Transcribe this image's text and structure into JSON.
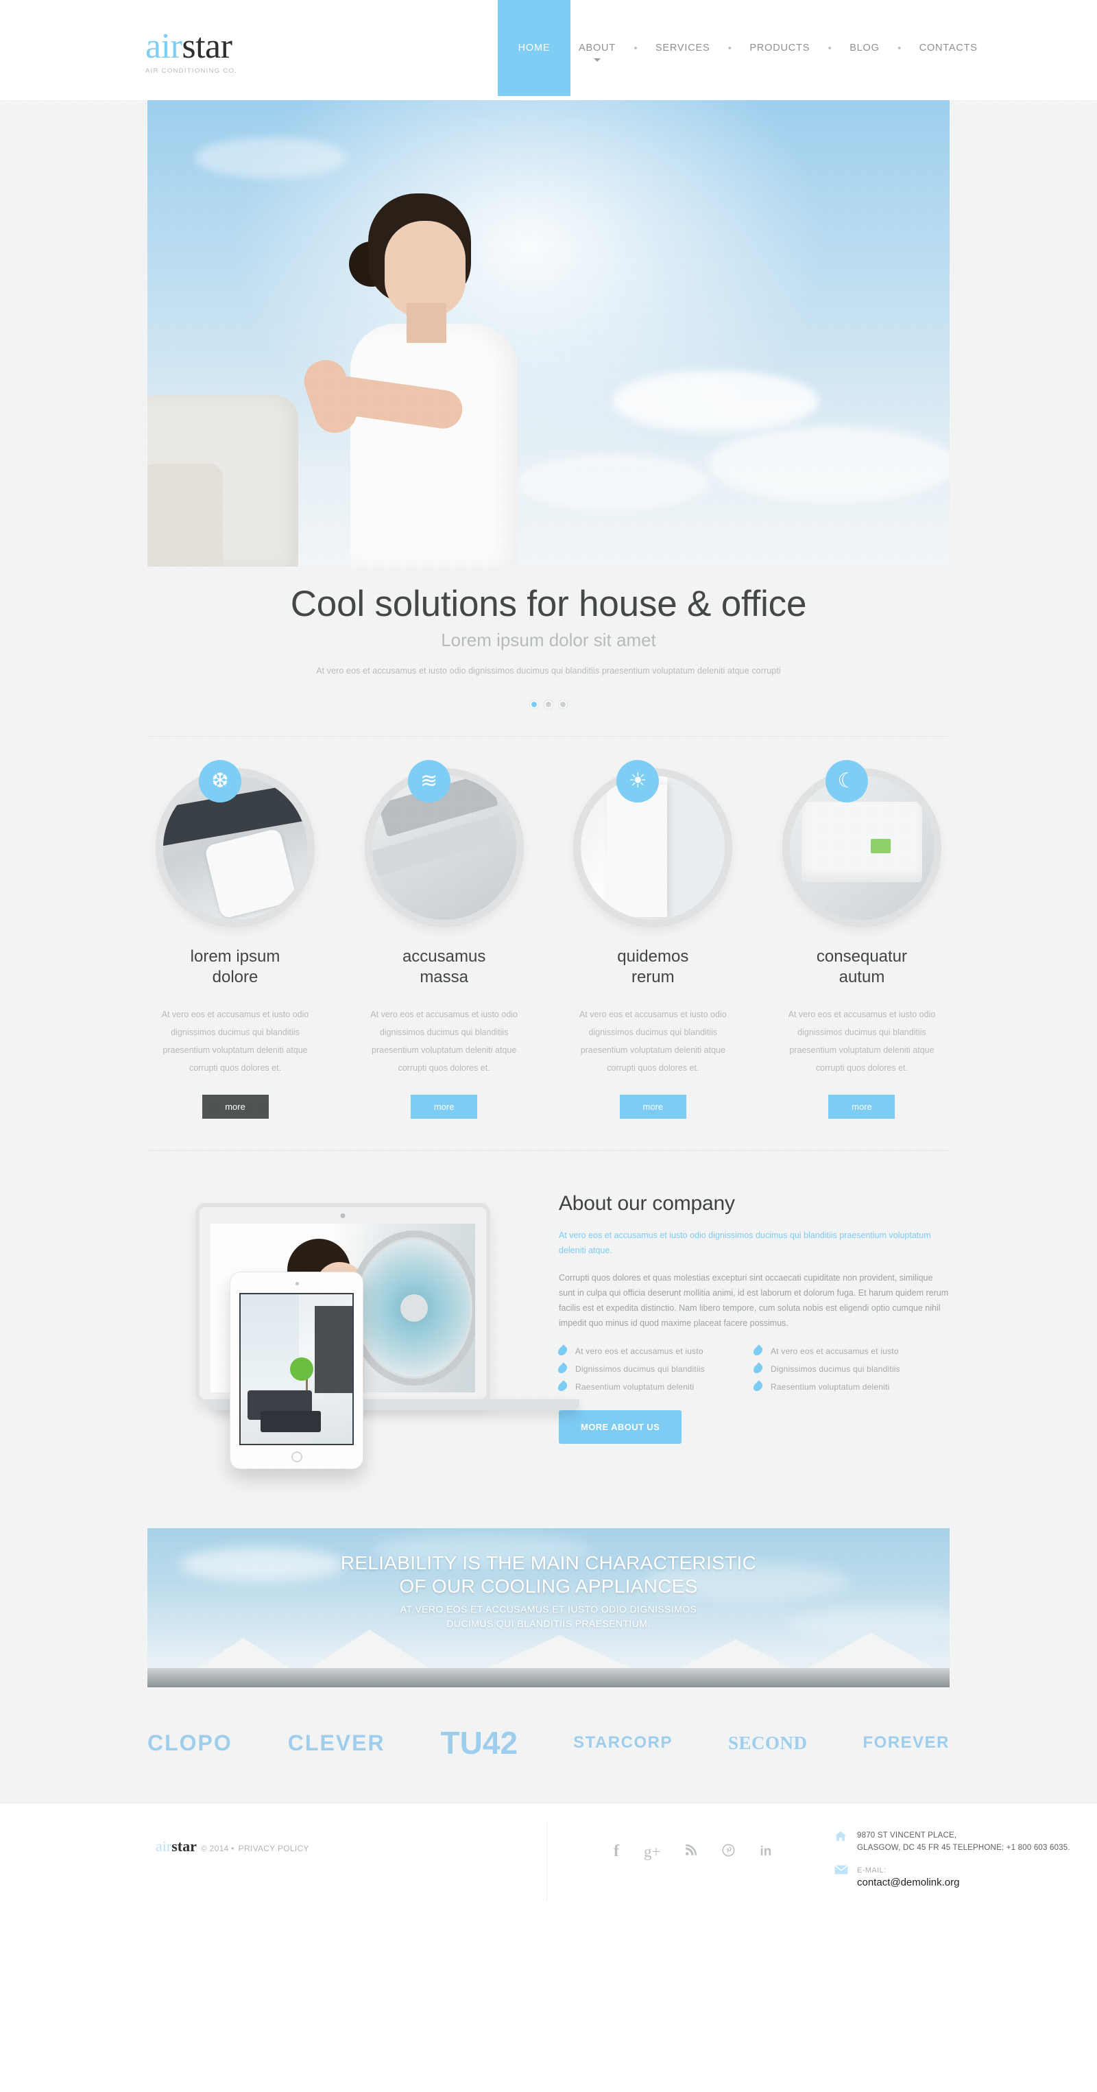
{
  "header": {
    "logo": {
      "part1": "air",
      "part2": "star",
      "tagline": "AIR CONDITIONING CO."
    },
    "nav": [
      {
        "label": "HOME",
        "active": true,
        "dropdown": false
      },
      {
        "label": "ABOUT",
        "active": false,
        "dropdown": true
      },
      {
        "label": "SERVICES",
        "active": false,
        "dropdown": false
      },
      {
        "label": "PRODUCTS",
        "active": false,
        "dropdown": false
      },
      {
        "label": "BLOG",
        "active": false,
        "dropdown": false
      },
      {
        "label": "CONTACTS",
        "active": false,
        "dropdown": false
      }
    ],
    "nav_separator": "•"
  },
  "hero": {
    "title": "Cool solutions for house & office",
    "subtitle": "Lorem ipsum dolor sit amet",
    "description": "At vero eos et accusamus et iusto odio dignissimos ducimus qui blanditiis praesentium voluptatum deleniti atque corrupti",
    "slides": [
      {
        "active": true
      },
      {
        "active": false
      },
      {
        "active": false
      }
    ]
  },
  "services": [
    {
      "icon": "snowflake-icon",
      "glyph": "❆",
      "title": "lorem ipsum\ndolore",
      "title_line1": "lorem ipsum",
      "title_line2": "dolore",
      "text": "At vero eos et accusamus et iusto odio dignissimos ducimus qui blanditiis praesentium voluptatum deleniti atque corrupti quos dolores et.",
      "button": "more",
      "button_style": "dark"
    },
    {
      "icon": "waves-icon",
      "glyph": "≋",
      "title_line1": "accusamus",
      "title_line2": "massa",
      "text": "At vero eos et accusamus et iusto odio dignissimos ducimus qui blanditiis praesentium voluptatum deleniti atque corrupti quos dolores et.",
      "button": "more",
      "button_style": "blue"
    },
    {
      "icon": "sun-icon",
      "glyph": "☀",
      "title_line1": "quidemos",
      "title_line2": "rerum",
      "text": "At vero eos et accusamus et iusto odio dignissimos ducimus qui blanditiis praesentium voluptatum deleniti atque corrupti quos dolores et.",
      "button": "more",
      "button_style": "blue"
    },
    {
      "icon": "moon-icon",
      "glyph": "☾",
      "title_line1": "consequatur",
      "title_line2": "autum",
      "text": "At vero eos et accusamus et iusto odio dignissimos ducimus qui blanditiis praesentium voluptatum deleniti atque corrupti quos dolores et.",
      "button": "more",
      "button_style": "blue"
    }
  ],
  "about": {
    "title": "About our company",
    "lead": "At vero eos et accusamus et iusto odio dignissimos ducimus qui blanditiis praesentium voluptatum deleniti atque.",
    "body": "Corrupti quos dolores et quas molestias excepturi sint occaecati cupiditate non provident, similique sunt in culpa qui officia deserunt mollitia animi, id est laborum et dolorum fuga. Et harum quidem rerum facilis est et expedita distinctio. Nam libero tempore, cum soluta nobis est eligendi optio cumque nihil impedit quo minus id quod maxime placeat facere possimus.",
    "list_left": [
      "At vero eos et accusamus et iusto",
      "Dignissimos ducimus qui blanditiis",
      "Raesentium voluptatum deleniti"
    ],
    "list_right": [
      "At vero eos et accusamus et iusto",
      "Dignissimos ducimus qui blanditiis",
      "Raesentium voluptatum deleniti"
    ],
    "button": "MORE ABOUT US"
  },
  "banner": {
    "heading_line1": "RELIABILITY IS THE MAIN CHARACTERISTIC",
    "heading_line2": "OF OUR COOLING APPLIANCES",
    "sub_line1": "AT VERO EOS ET ACCUSAMUS ET IUSTO ODIO DIGNISSIMOS",
    "sub_line2": "DUCIMUS QUI BLANDITIIS PRAESENTIUM."
  },
  "partners": [
    {
      "name": "CLOPO"
    },
    {
      "name": "CLEVER"
    },
    {
      "name": "TU42"
    },
    {
      "name": "STARCORP"
    },
    {
      "name": "SECOND"
    },
    {
      "name": "FOREVER"
    }
  ],
  "footer": {
    "logo_part1": "air",
    "logo_part2": "star",
    "copyright": "© 2014 •",
    "privacy": "PRIVACY POLICY",
    "social": [
      {
        "name": "facebook-icon",
        "glyph": "f"
      },
      {
        "name": "google-plus-icon",
        "glyph": "g+"
      },
      {
        "name": "rss-icon",
        "glyph": "⌢"
      },
      {
        "name": "pinterest-icon",
        "glyph": "Ⓟ"
      },
      {
        "name": "linkedin-icon",
        "glyph": "in"
      }
    ],
    "address_line1": "9870 ST VINCENT PLACE,",
    "address_line2": "GLASGOW, DC 45 FR 45 TELEPHONE:  +1 800 603 6035.",
    "email_label": "E-MAIL:",
    "email": "contact@demolink.org"
  },
  "colors": {
    "accent": "#7ecdf5",
    "dark_button": "#515455",
    "page_bg": "#f4f5f5",
    "body_text": "#b8babb"
  }
}
